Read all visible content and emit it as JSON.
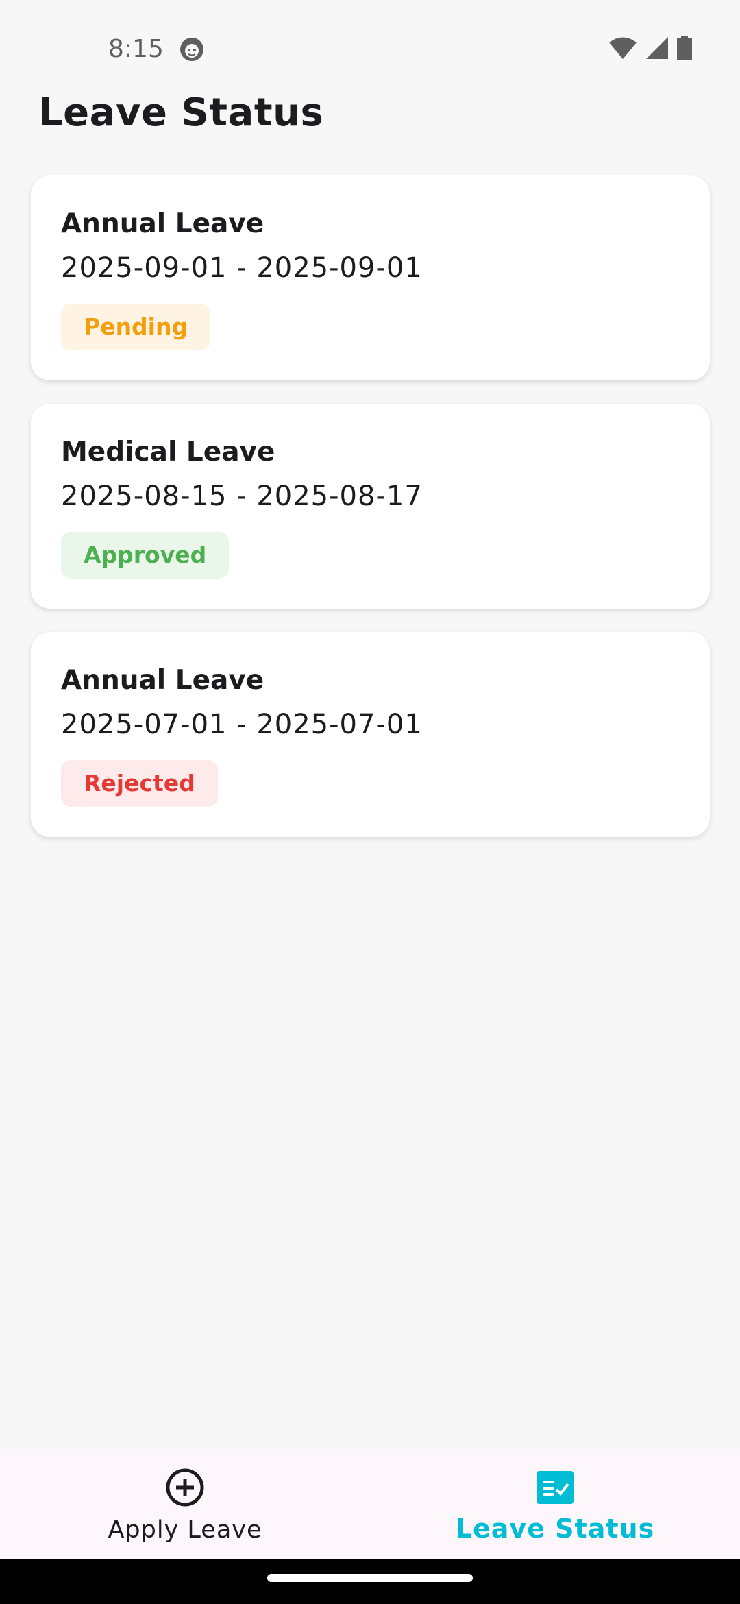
{
  "status_bar": {
    "time": "8:15",
    "icons": [
      "app-notification-icon",
      "wifi-icon",
      "cellular-signal-icon",
      "battery-icon"
    ]
  },
  "header": {
    "title": "Leave Status"
  },
  "leaves": [
    {
      "type": "Annual Leave",
      "dates": "2025-09-01 - 2025-09-01",
      "status": "Pending",
      "status_color": "#f59e0b",
      "status_bg": "#fff3e3"
    },
    {
      "type": "Medical Leave",
      "dates": "2025-08-15 - 2025-08-17",
      "status": "Approved",
      "status_color": "#4caf50",
      "status_bg": "#eaf6ea"
    },
    {
      "type": "Annual Leave",
      "dates": "2025-07-01 - 2025-07-01",
      "status": "Rejected",
      "status_color": "#e53935",
      "status_bg": "#fdeaea"
    }
  ],
  "bottom_nav": {
    "items": [
      {
        "label": "Apply Leave",
        "icon": "add-circle-icon",
        "active": false
      },
      {
        "label": "Leave Status",
        "icon": "fact-check-icon",
        "active": true
      }
    ],
    "active_color": "#00bcd4"
  }
}
